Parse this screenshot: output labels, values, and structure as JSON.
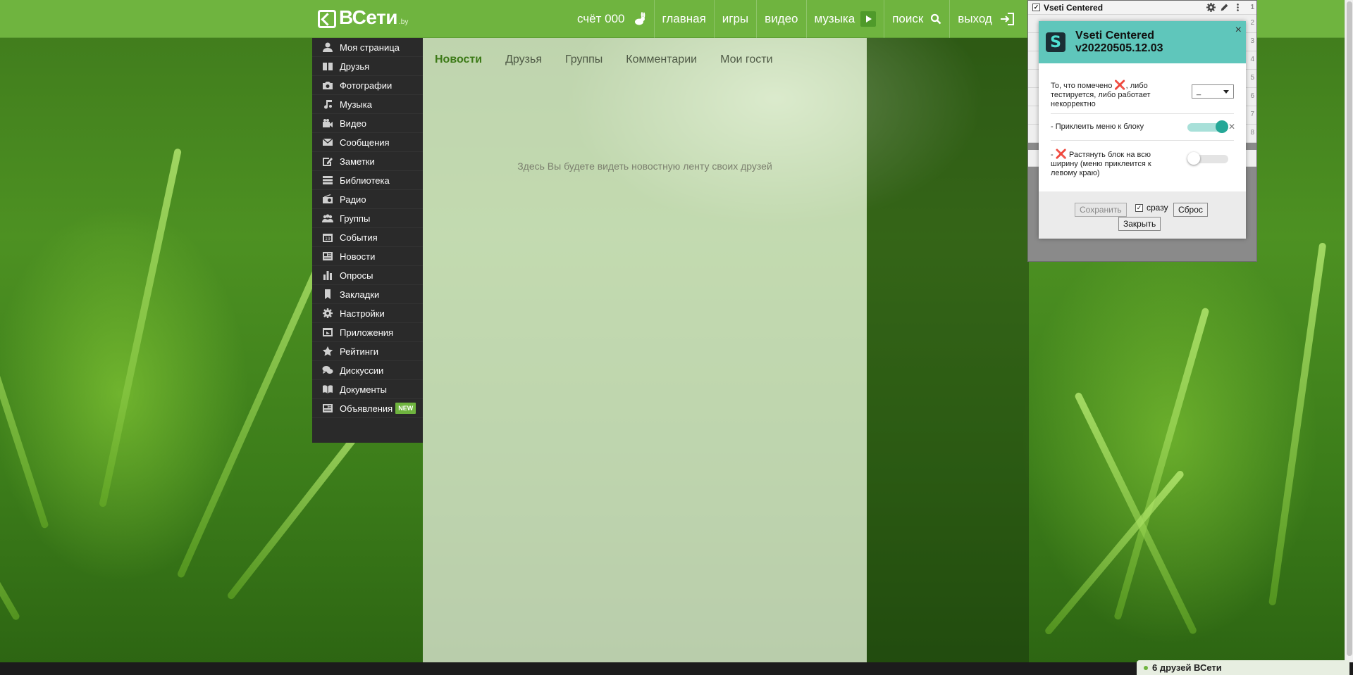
{
  "header": {
    "logo_text": "ВСети",
    "logo_suffix": ".by",
    "score_label": "счёт 000",
    "nav": [
      "главная",
      "игры",
      "видео",
      "музыка",
      "поиск",
      "выход"
    ]
  },
  "sidebar": {
    "items": [
      {
        "label": "Моя страница",
        "icon": "user-icon"
      },
      {
        "label": "Друзья",
        "icon": "friends-icon"
      },
      {
        "label": "Фотографии",
        "icon": "camera-icon"
      },
      {
        "label": "Музыка",
        "icon": "music-note-icon"
      },
      {
        "label": "Видео",
        "icon": "video-camera-icon"
      },
      {
        "label": "Сообщения",
        "icon": "envelope-icon"
      },
      {
        "label": "Заметки",
        "icon": "edit-note-icon"
      },
      {
        "label": "Библиотека",
        "icon": "library-icon"
      },
      {
        "label": "Радио",
        "icon": "radio-icon"
      },
      {
        "label": "Группы",
        "icon": "groups-icon"
      },
      {
        "label": "События",
        "icon": "calendar-icon"
      },
      {
        "label": "Новости",
        "icon": "newspaper-icon"
      },
      {
        "label": "Опросы",
        "icon": "bar-chart-icon"
      },
      {
        "label": "Закладки",
        "icon": "bookmark-icon"
      },
      {
        "label": "Настройки",
        "icon": "gear-icon"
      },
      {
        "label": "Приложения",
        "icon": "apps-icon"
      },
      {
        "label": "Рейтинги",
        "icon": "star-icon"
      },
      {
        "label": "Дискуссии",
        "icon": "chat-bubbles-icon"
      },
      {
        "label": "Документы",
        "icon": "book-icon"
      },
      {
        "label": "Объявления",
        "icon": "ads-icon",
        "badge": "NEW"
      }
    ]
  },
  "main": {
    "tabs": [
      "Новости",
      "Друзья",
      "Группы",
      "Комментарии",
      "Мои гости"
    ],
    "active_tab": "Новости",
    "empty_message": "Здесь Вы будете видеть новостную ленту своих друзей"
  },
  "script_manager": {
    "script_name": "Vseti Centered",
    "row_numbers": [
      "1",
      "2",
      "3",
      "4",
      "5",
      "6",
      "7",
      "8"
    ]
  },
  "dialog": {
    "logo_letter": "S",
    "title_line1": "Vseti Centered",
    "title_line2": "v20220505.12.03",
    "close_glyph": "×",
    "option1_text_a": "То, что помечено",
    "option1_text_b": ", либо тестируется, либо работает некорректно",
    "option1_select_value": "_",
    "option2_text": "- Приклеить меню к блоку",
    "option2_enabled": true,
    "option3_prefix": "-",
    "option3_text": "Растянуть блок на всю ширину (меню приклеится к левому краю)",
    "option3_enabled": false,
    "mark_glyph": "❌",
    "save_label": "Сохранить",
    "immediately_label": "сразу",
    "immediately_checked": true,
    "reset_label": "Сброс",
    "close_label": "Закрыть"
  },
  "footer": {
    "friends_online": "6 друзей ВСети"
  },
  "colors": {
    "topbar": "#6fb43f",
    "sidebar": "#2a2a2a",
    "dialog_header": "#5fc6bb",
    "toggle_on": "#25a797",
    "mark": "#e0243a"
  }
}
